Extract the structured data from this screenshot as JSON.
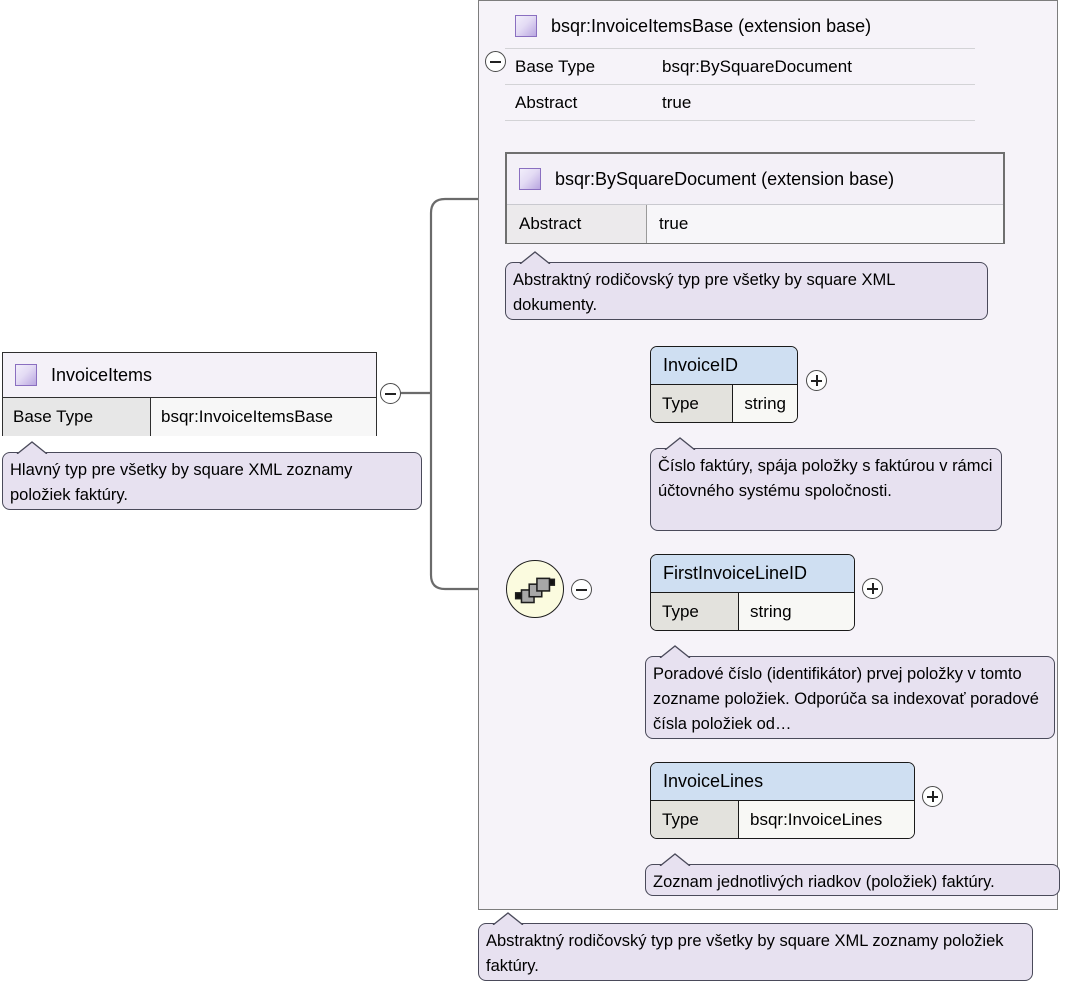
{
  "diagram": {
    "type": "xsd-complextype-diagram",
    "root": {
      "name": "InvoiceItems",
      "icon": "complex-type-icon",
      "rows": [
        {
          "key": "Base Type",
          "value": "bsqr:InvoiceItemsBase"
        }
      ],
      "annotation": "Hlavný typ pre všetky by square XML zoznamy položiek faktúry.",
      "toggle": "minus"
    },
    "container": {
      "annotation": "Abstraktný rodičovský typ pre všetky by square XML zoznamy položiek faktúry.",
      "extension_bases": [
        {
          "name": "bsqr:InvoiceItemsBase (extension base)",
          "icon": "complex-type-icon",
          "toggle": "minus",
          "rows": [
            {
              "key": "Base Type",
              "value": "bsqr:BySquareDocument"
            },
            {
              "key": "Abstract",
              "value": "true"
            }
          ]
        },
        {
          "name": "bsqr:BySquareDocument (extension base)",
          "icon": "complex-type-icon",
          "rows": [
            {
              "key": "Abstract",
              "value": "true"
            }
          ],
          "annotation": "Abstraktný rodičovský typ pre všetky by square XML dokumenty."
        }
      ],
      "compositor": {
        "kind": "sequence-icon",
        "toggle": "minus"
      },
      "elements": [
        {
          "name": "InvoiceID",
          "toggle": "plus",
          "rows": [
            {
              "key": "Type",
              "value": "string"
            }
          ],
          "annotation": "Číslo faktúry, spája položky s faktúrou v rámci účtovného systému spoločnosti."
        },
        {
          "name": "FirstInvoiceLineID",
          "toggle": "plus",
          "rows": [
            {
              "key": "Type",
              "value": "string"
            }
          ],
          "annotation": "Poradové číslo (identifikátor) prvej položky v tomto zozname položiek. Odporúča sa indexovať poradové čísla položiek od…"
        },
        {
          "name": "InvoiceLines",
          "toggle": "plus",
          "rows": [
            {
              "key": "Type",
              "value": "bsqr:InvoiceLines"
            }
          ],
          "annotation": "Zoznam jednotlivých riadkov (položiek) faktúry."
        }
      ]
    },
    "colors": {
      "container_fill": "#f6f3f9",
      "element_header": "#cfdff2",
      "annotation_fill": "#e7e1f0",
      "key_cell": "#e3e2dd",
      "sequence_fill": "#fbfbdf",
      "line": "#6b6b6b"
    }
  }
}
